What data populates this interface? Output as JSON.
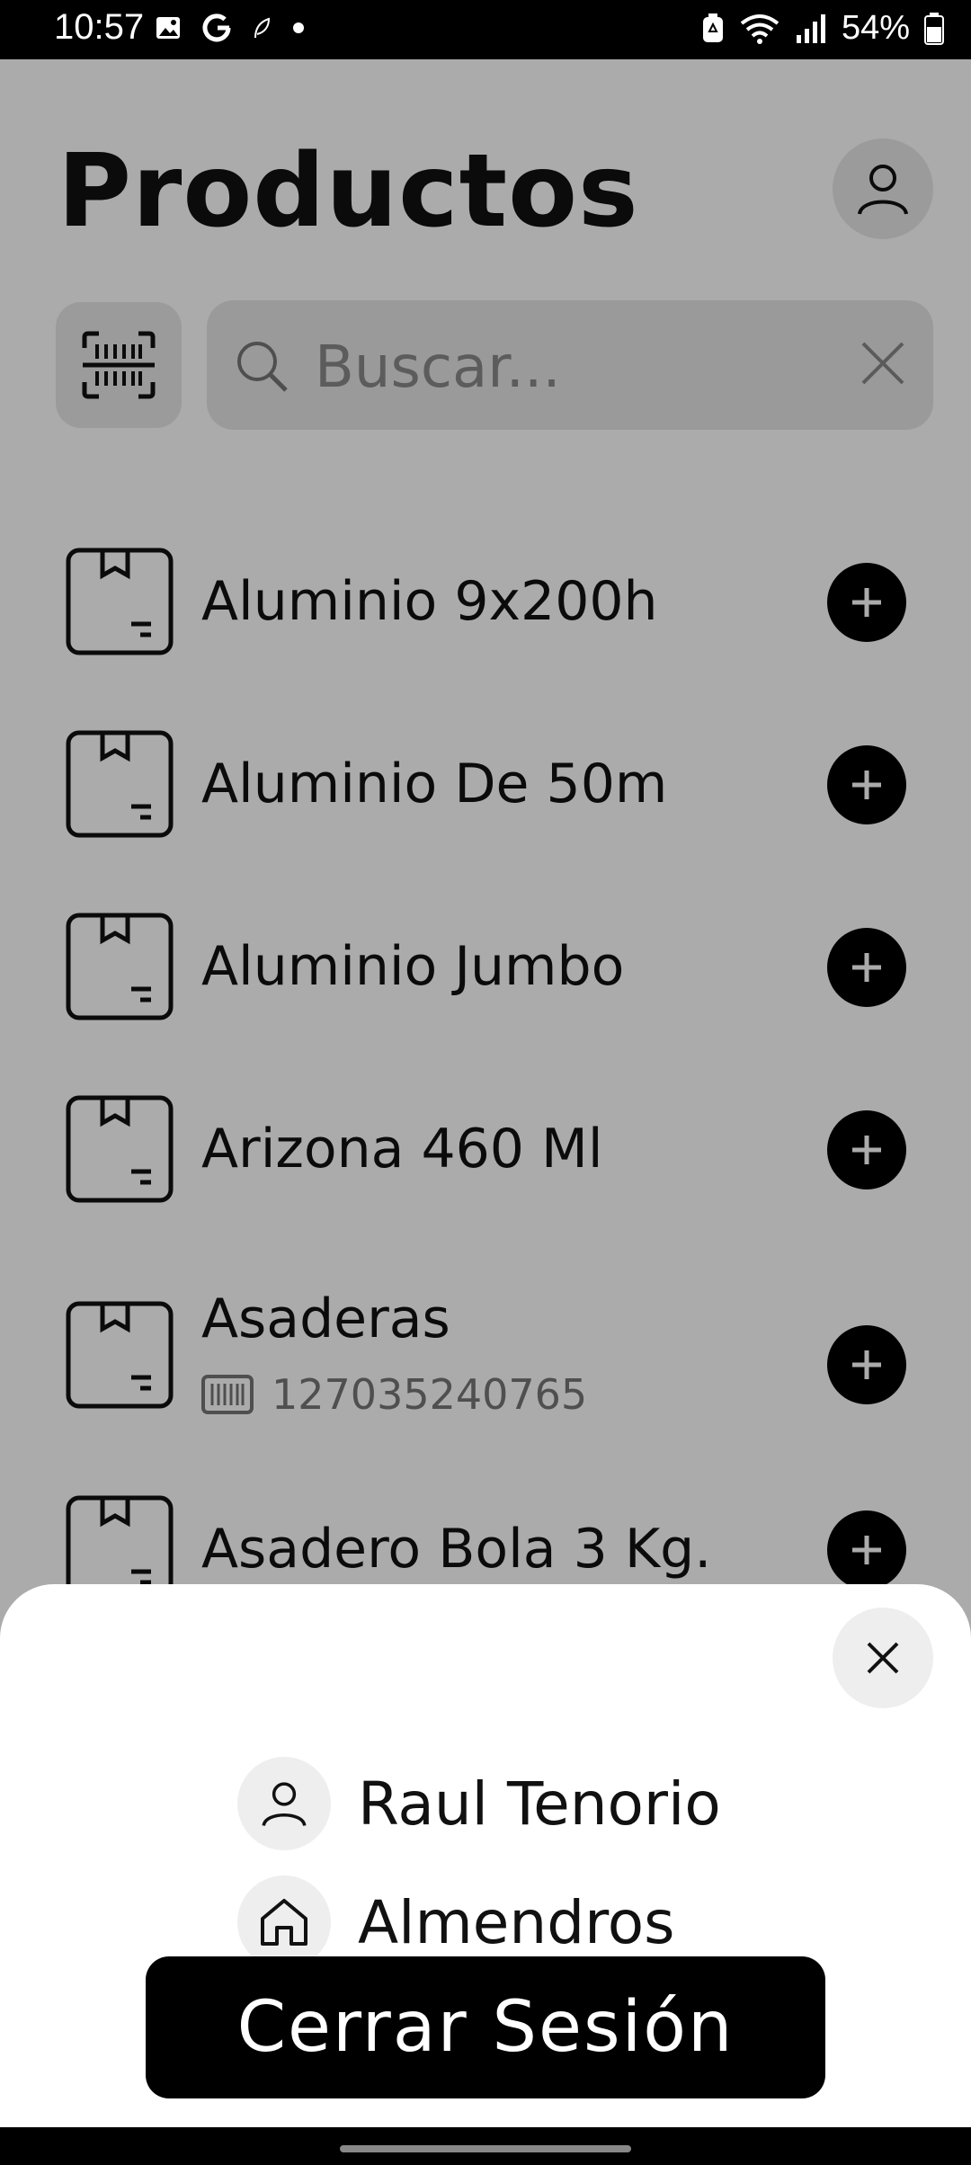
{
  "status_bar": {
    "time": "10:57",
    "battery_pct": "54%",
    "left_icons": [
      "image-icon",
      "google-icon",
      "leaf-icon",
      "dot-icon"
    ],
    "right_icons": [
      "battery-saver-icon",
      "wifi-icon",
      "signal-icon",
      "battery-icon"
    ]
  },
  "header": {
    "title": "Productos"
  },
  "search": {
    "placeholder": "Buscar..."
  },
  "products": [
    {
      "name": "Aluminio 9x200h",
      "barcode": ""
    },
    {
      "name": "Aluminio De 50m",
      "barcode": ""
    },
    {
      "name": "Aluminio Jumbo",
      "barcode": ""
    },
    {
      "name": "Arizona 460 Ml",
      "barcode": ""
    },
    {
      "name": "Asaderas",
      "barcode": "127035240765"
    },
    {
      "name": "Asadero Bola 3 Kg.",
      "barcode": ""
    }
  ],
  "session_sheet": {
    "user_name": "Raul Tenorio",
    "branch": "Almendros",
    "logout_label": "Cerrar Sesión"
  },
  "colors": {
    "accent": "#000000",
    "overlay": "#a8a8a8",
    "chip_bg": "#e8e8e8"
  }
}
